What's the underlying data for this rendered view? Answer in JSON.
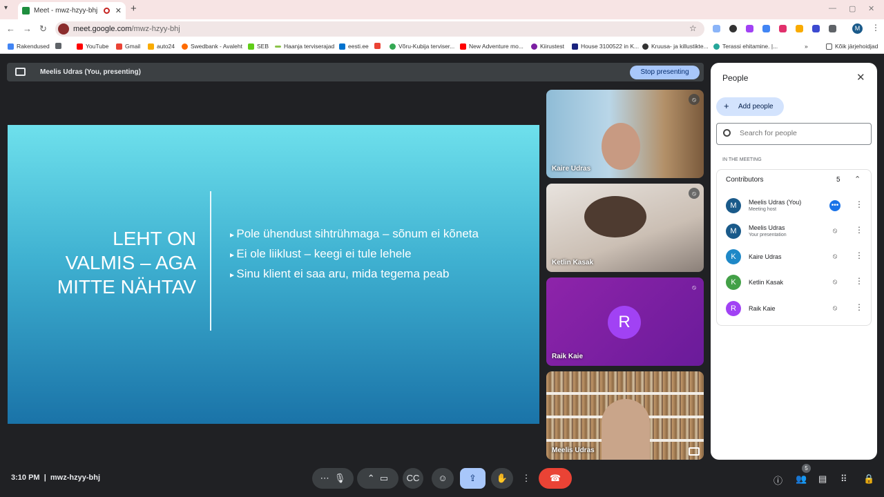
{
  "browser": {
    "tab_title": "Meet - mwz-hzyy-bhj",
    "url_host": "meet.google.com",
    "url_path": "/mwz-hzyy-bhj",
    "bookmarks": [
      "Rakendused",
      "YouTube",
      "Gmail",
      "auto24",
      "Swedbank - Avaleht",
      "SEB",
      "Haanja terviserajad",
      "eesti.ee",
      "Võru-Kubija terviser...",
      "New Adventure mo...",
      "Kiirustest",
      "House 3100522 in K...",
      "Kruusa- ja killustikte...",
      "Terassi ehitamine. |..."
    ],
    "all_bookmarks": "Kõik järjehoidjad",
    "profile_initial": "M"
  },
  "presenting": {
    "label": "Meelis Udras (You, presenting)",
    "stop_label": "Stop presenting"
  },
  "slide": {
    "title_lines": [
      "LEHT ON",
      "VALMIS – AGA",
      "MITTE NÄHTAV"
    ],
    "bullets": [
      "Pole ühendust sihtrühmaga – sõnum ei kõneta",
      "Ei ole liiklust – keegi ei tule lehele",
      "Sinu klient ei saa aru, mida tegema peab"
    ]
  },
  "tiles": [
    {
      "name": "Kaire Udras"
    },
    {
      "name": "Ketlin Kasak"
    },
    {
      "name": "Raik Kaie",
      "initial": "R"
    },
    {
      "name": "Meelis Udras"
    }
  ],
  "people": {
    "title": "People",
    "add_label": "Add people",
    "search_placeholder": "Search for people",
    "section_label": "IN THE MEETING",
    "group_label": "Contributors",
    "group_count": "5",
    "members": [
      {
        "initial": "M",
        "name": "Meelis Udras (You)",
        "sub": "Meeting host",
        "color": "#1a5a8a"
      },
      {
        "initial": "M",
        "name": "Meelis Udras",
        "sub": "Your presentation",
        "color": "#1a5a8a"
      },
      {
        "initial": "K",
        "name": "Kaire Udras",
        "sub": "",
        "color": "#1e88c7"
      },
      {
        "initial": "K",
        "name": "Ketlin Kasak",
        "sub": "",
        "color": "#43a047"
      },
      {
        "initial": "R",
        "name": "Raik Kaie",
        "sub": "",
        "color": "#a142f4"
      }
    ]
  },
  "bottom": {
    "time": "3:10 PM",
    "meeting_code": "mwz-hzyy-bhj",
    "people_badge": "5"
  }
}
